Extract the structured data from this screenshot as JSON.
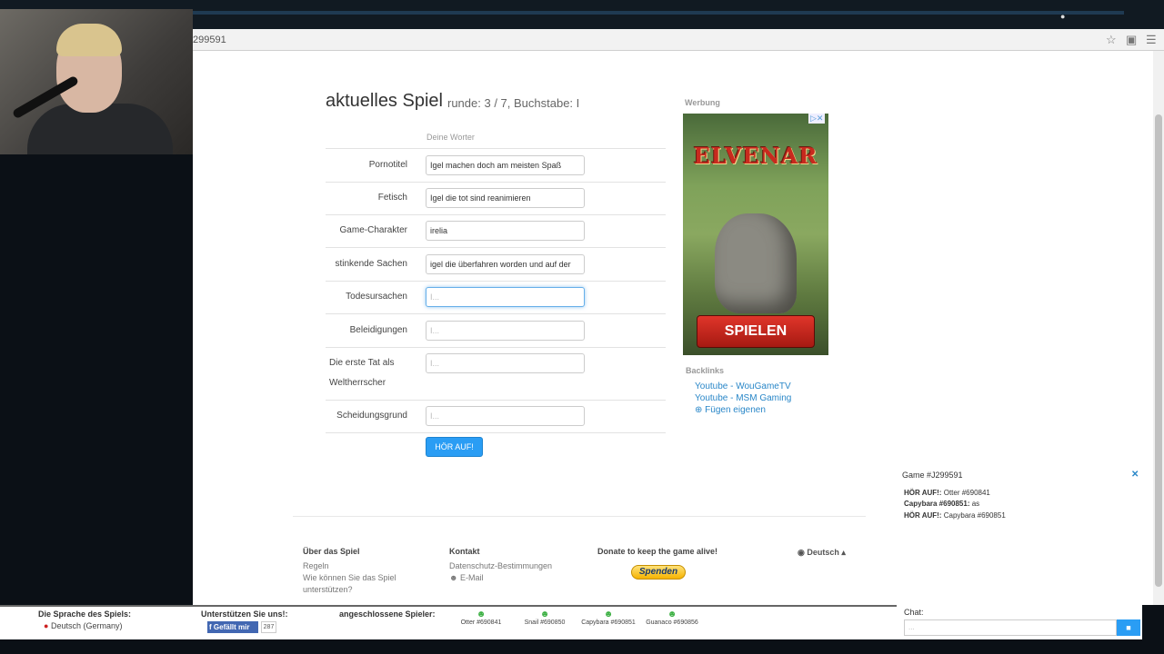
{
  "browser": {
    "url_fragment": "299591",
    "star_icon": "star-icon",
    "menu_icon": "menu-icon"
  },
  "game": {
    "title": "aktuelles Spiel",
    "subtitle": "runde: 3 / 7, Buchstabe: I",
    "words_header": "Deine Worter",
    "rows": [
      {
        "label": "Pornotitel",
        "value": "Igel machen doch am meisten Spaß",
        "placeholder": "I..."
      },
      {
        "label": "Fetisch",
        "value": "Igel die tot sind reanimieren",
        "placeholder": "I..."
      },
      {
        "label": "Game-Charakter",
        "value": "irelia",
        "placeholder": "I..."
      },
      {
        "label": "stinkende Sachen",
        "value": "igel die überfahren worden und auf der",
        "placeholder": "I..."
      },
      {
        "label": "Todesursachen",
        "value": "",
        "placeholder": "I..."
      },
      {
        "label": "Beleidigungen",
        "value": "",
        "placeholder": "I..."
      },
      {
        "label": "Die erste Tat als Weltherrscher",
        "value": "",
        "placeholder": "I..."
      },
      {
        "label": "Scheidungsgrund",
        "value": "",
        "placeholder": "I..."
      }
    ],
    "stop_button": "HÖR AUF!"
  },
  "ad": {
    "label": "Werbung",
    "brand": "ELVENAR",
    "cta": "SPIELEN"
  },
  "backlinks": {
    "header": "Backlinks",
    "links": [
      "Youtube - WouGameTV",
      "Youtube - MSM Gaming"
    ],
    "add_label": "Fügen eigenen"
  },
  "footer": {
    "about_header": "Über das Spiel",
    "about_links": [
      "Regeln",
      "Wie können Sie das Spiel",
      "unterstützen?"
    ],
    "contact_header": "Kontakt",
    "contact_links": [
      "Datenschutz-Bestimmungen",
      "E-Mail"
    ],
    "donate_header": "Donate to keep the game alive!",
    "donate_button": "Spenden",
    "language": "Deutsch"
  },
  "chat": {
    "title": "Game #J299591",
    "messages": [
      {
        "author": "HÖR AUF!:",
        "text": "Otter #690841"
      },
      {
        "author": "Capybara #690851:",
        "text": "as"
      },
      {
        "author": "HÖR AUF!:",
        "text": "Capybara #690851"
      }
    ],
    "input_label": "Chat:",
    "input_placeholder": "..."
  },
  "bottom": {
    "language_header": "Die Sprache des Spiels:",
    "language_value": "Deutsch (Germany)",
    "support_header": "Unterstützen Sie uns!:",
    "fb_label": "Gefällt mir",
    "fb_count": "287",
    "players_header": "angeschlossene Spieler:",
    "players": [
      "Otter #690841",
      "Snail #690850",
      "Capybara #690851",
      "Guanaco #690856"
    ]
  }
}
